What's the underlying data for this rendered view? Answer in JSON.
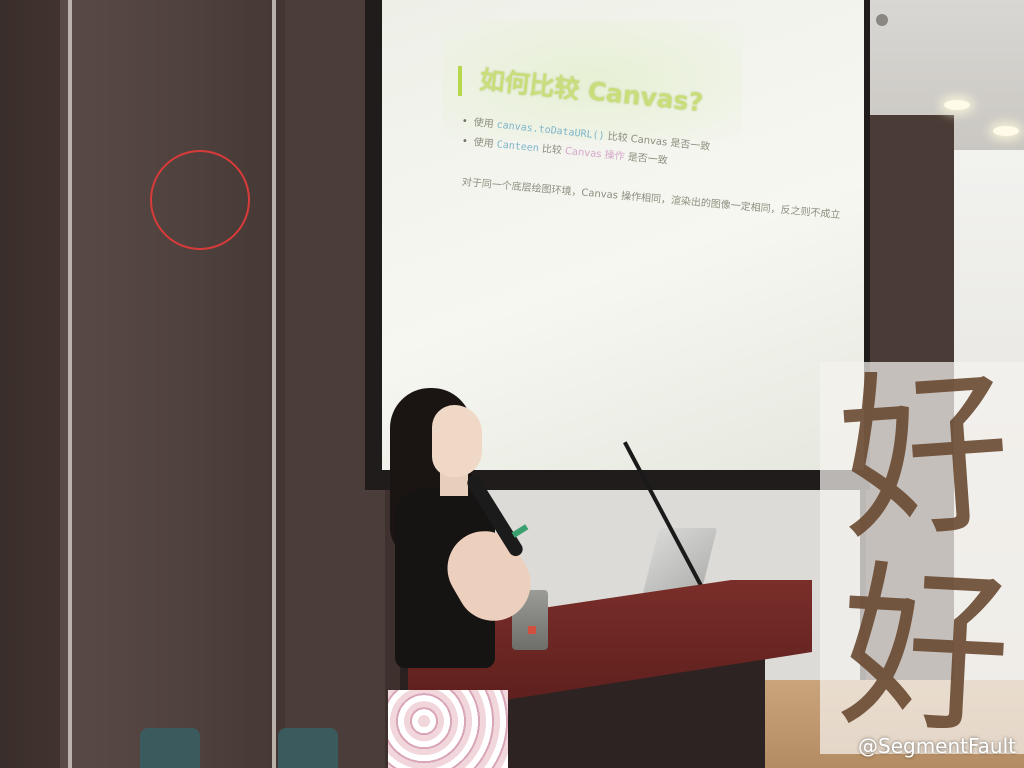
{
  "slide": {
    "title": "如何比较 Canvas?",
    "line1_prefix": "使用 ",
    "line1_code": "canvas.toDataURL()",
    "line1_suffix": " 比较 Canvas 是否一致",
    "line2_prefix": "使用 ",
    "line2_highlight": "Canteen",
    "line2_mid": " 比较 ",
    "line2_pink": "Canvas 操作",
    "line2_suffix": " 是否一致",
    "line3": "对于同一个底层绘图环境，Canvas 操作相同，渲染出的图像一定相同，反之则不成立",
    "bullet": "•"
  },
  "overlay": {
    "calligraphy_char_1": "好",
    "calligraphy_char_2": "好",
    "watermark": "@SegmentFault"
  }
}
